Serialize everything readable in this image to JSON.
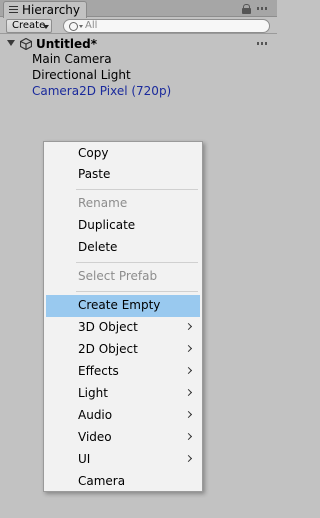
{
  "window": {
    "tab_title": "Hierarchy"
  },
  "toolbar": {
    "create_label": "Create",
    "search_placeholder": "All"
  },
  "scene": {
    "title": "Untitled*",
    "items": [
      {
        "label": "Main Camera",
        "kind": "gameobject"
      },
      {
        "label": "Directional Light",
        "kind": "gameobject"
      },
      {
        "label": "Camera2D Pixel (720p)",
        "kind": "prefab"
      }
    ]
  },
  "context_menu": {
    "groups": [
      [
        {
          "label": "Copy",
          "enabled": true
        },
        {
          "label": "Paste",
          "enabled": true
        }
      ],
      [
        {
          "label": "Rename",
          "enabled": false
        },
        {
          "label": "Duplicate",
          "enabled": true
        },
        {
          "label": "Delete",
          "enabled": true
        }
      ],
      [
        {
          "label": "Select Prefab",
          "enabled": false
        }
      ],
      [
        {
          "label": "Create Empty",
          "enabled": true,
          "highlighted": true
        },
        {
          "label": "3D Object",
          "enabled": true,
          "submenu": true
        },
        {
          "label": "2D Object",
          "enabled": true,
          "submenu": true
        },
        {
          "label": "Effects",
          "enabled": true,
          "submenu": true
        },
        {
          "label": "Light",
          "enabled": true,
          "submenu": true
        },
        {
          "label": "Audio",
          "enabled": true,
          "submenu": true
        },
        {
          "label": "Video",
          "enabled": true,
          "submenu": true
        },
        {
          "label": "UI",
          "enabled": true,
          "submenu": true
        },
        {
          "label": "Camera",
          "enabled": true
        }
      ]
    ]
  },
  "colors": {
    "panel_background": "#c2c2c2",
    "menu_background": "#f2f2f2",
    "menu_highlight": "#99c9ef",
    "prefab_text": "#1a2a9c",
    "disabled_text": "#8d8d8d"
  },
  "icons": {
    "tab": "hierarchy-list-icon",
    "lock": "lock-icon",
    "panel_menu": "kebab-menu-icon",
    "search": "search-icon",
    "scene": "unity-logo-icon",
    "foldout": "foldout-arrow-icon",
    "submenu": "chevron-right-icon"
  }
}
